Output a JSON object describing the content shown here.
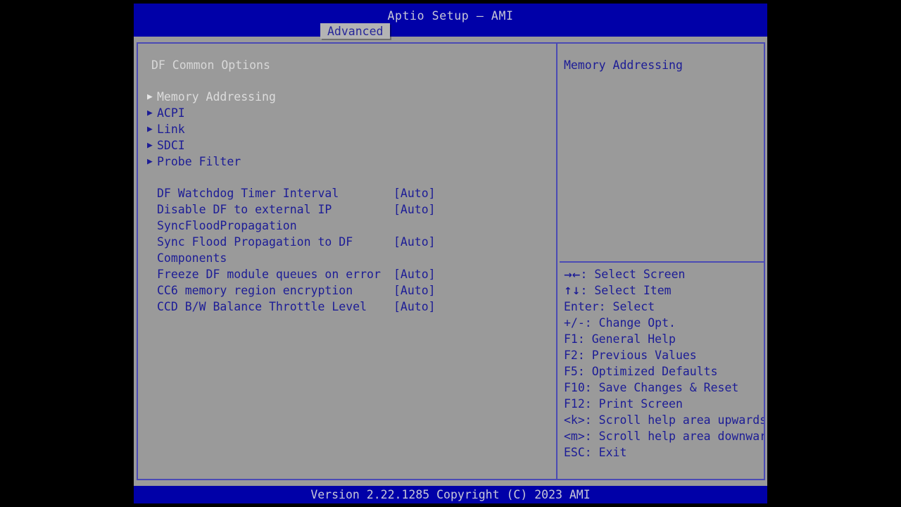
{
  "window": {
    "title": "Aptio Setup – AMI",
    "footer": "Version 2.22.1285 Copyright (C) 2023 AMI"
  },
  "tabs": [
    {
      "label": "Advanced",
      "active": true
    }
  ],
  "left_pane": {
    "section_title": "DF Common Options",
    "submenus": [
      {
        "label": "Memory Addressing",
        "arrow": "▶",
        "selected": true
      },
      {
        "label": "ACPI",
        "arrow": "▶",
        "selected": false
      },
      {
        "label": "Link",
        "arrow": "▶",
        "selected": false
      },
      {
        "label": "SDCI",
        "arrow": "▶",
        "selected": false
      },
      {
        "label": "Probe Filter",
        "arrow": "▶",
        "selected": false
      }
    ],
    "options": [
      {
        "label": "DF Watchdog Timer Interval",
        "value": "[Auto]"
      },
      {
        "label": "Disable DF to external IP",
        "value": "[Auto]"
      },
      {
        "label": "SyncFloodPropagation",
        "value": ""
      },
      {
        "label": "Sync Flood Propagation to DF",
        "value": "[Auto]"
      },
      {
        "label": "Components",
        "value": ""
      },
      {
        "label": "Freeze DF module queues on error",
        "value": "[Auto]"
      },
      {
        "label": "CC6 memory region encryption",
        "value": "[Auto]"
      },
      {
        "label": "CCD B/W Balance Throttle Level",
        "value": "[Auto]"
      }
    ]
  },
  "right_pane": {
    "help_text": "Memory Addressing",
    "hotkeys": [
      {
        "symbol": "→←",
        "text": ": Select Screen"
      },
      {
        "symbol": "↑↓",
        "text": ": Select Item"
      },
      {
        "symbol": "",
        "text": "Enter: Select"
      },
      {
        "symbol": "",
        "text": "+/-: Change Opt."
      },
      {
        "symbol": "",
        "text": "F1: General Help"
      },
      {
        "symbol": "",
        "text": "F2: Previous Values"
      },
      {
        "symbol": "",
        "text": "F5: Optimized Defaults"
      },
      {
        "symbol": "",
        "text": "F10: Save Changes & Reset"
      },
      {
        "symbol": "",
        "text": "F12: Print Screen"
      },
      {
        "symbol": "",
        "text": "<k>: Scroll help area upwards"
      },
      {
        "symbol": "",
        "text": "<m>: Scroll help area downwards"
      },
      {
        "symbol": "",
        "text": "ESC: Exit"
      }
    ]
  },
  "colors": {
    "header_blue": "#0000a8",
    "panel_gray": "#9a9a9a",
    "border_blue": "#4a4ab4",
    "text_blue": "#1c1c96",
    "text_light": "#d8d8d8",
    "tab_gray": "#b4b4b4"
  }
}
